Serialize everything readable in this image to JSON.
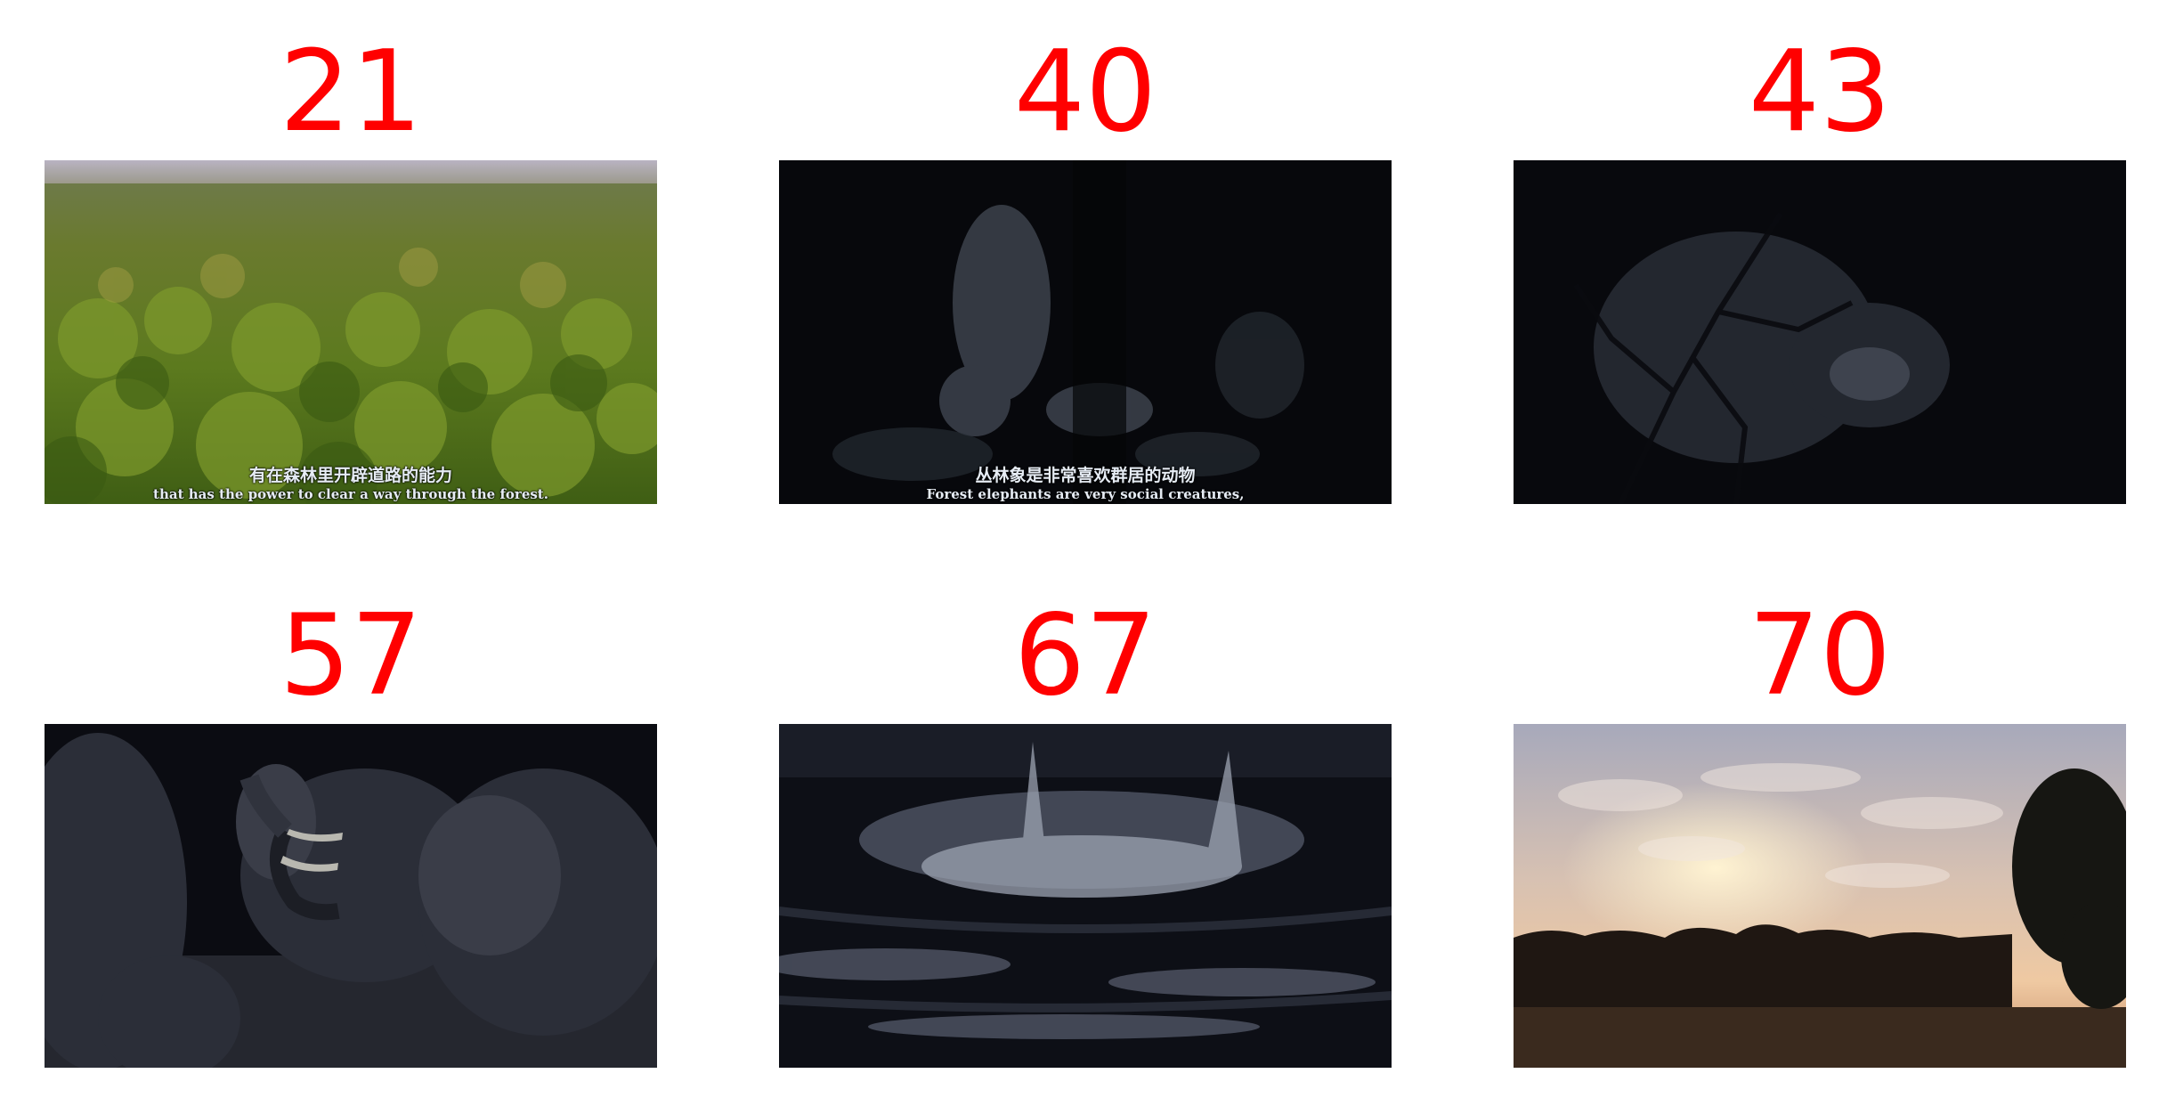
{
  "frames": [
    {
      "number": "21",
      "subtitle_zh": "有在森林里开辟道路的能力",
      "subtitle_en": "that has the power to clear a way through the forest."
    },
    {
      "number": "40",
      "subtitle_zh": "丛林象是非常喜欢群居的动物",
      "subtitle_en": "Forest elephants are very social creatures,"
    },
    {
      "number": "43"
    },
    {
      "number": "57"
    },
    {
      "number": "67"
    },
    {
      "number": "70"
    }
  ],
  "colors": {
    "label": "#ff0000",
    "background": "#ffffff"
  }
}
